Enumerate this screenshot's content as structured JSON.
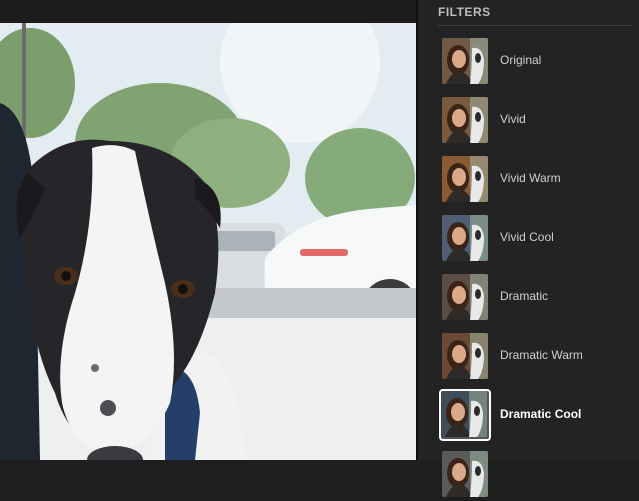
{
  "photo": {
    "subject": "dog-photo"
  },
  "filters_panel": {
    "title": "FILTERS",
    "selected": "Dramatic Cool",
    "items": [
      {
        "label": "Original",
        "tone": "#6f5a48"
      },
      {
        "label": "Vivid",
        "tone": "#7a5a3e"
      },
      {
        "label": "Vivid Warm",
        "tone": "#8a5a34"
      },
      {
        "label": "Vivid Cool",
        "tone": "#4f5e70"
      },
      {
        "label": "Dramatic",
        "tone": "#5a4c42"
      },
      {
        "label": "Dramatic Warm",
        "tone": "#6a4a34"
      },
      {
        "label": "Dramatic Cool",
        "tone": "#3f4c5a"
      },
      {
        "label": "",
        "tone": "#5a5a5a"
      }
    ]
  }
}
